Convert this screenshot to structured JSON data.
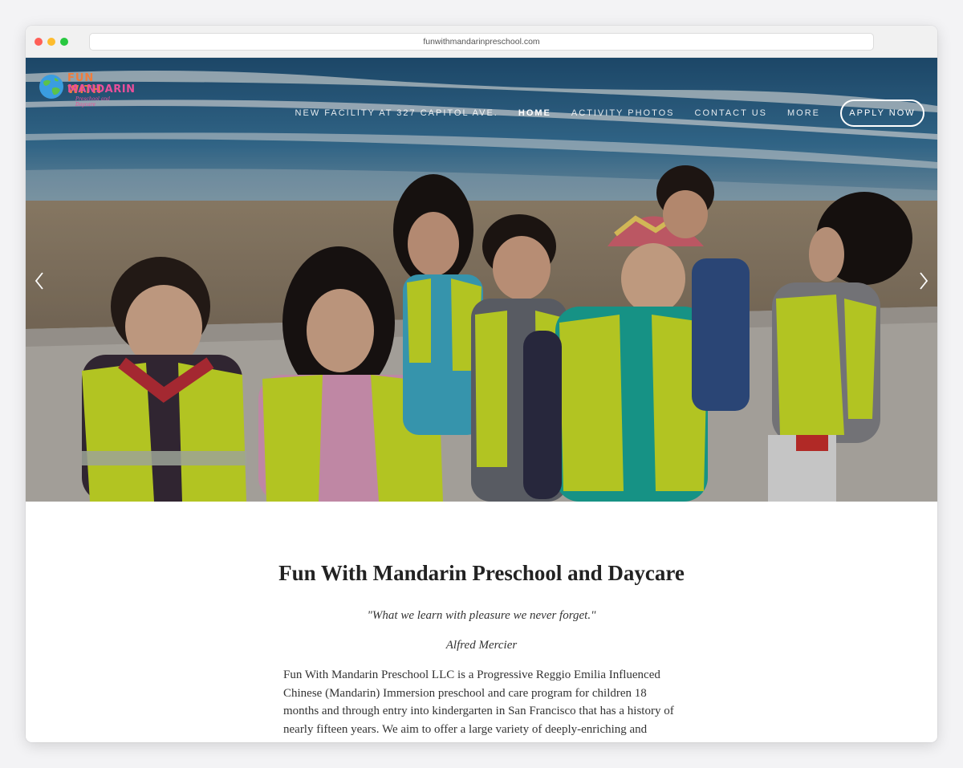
{
  "browser": {
    "url": "funwithmandarinpreschool.com"
  },
  "logo": {
    "line1": "FUN WITH",
    "line2": "MANDARIN",
    "line3": "Preschool and Daycare",
    "icon": "globe-icon"
  },
  "nav": {
    "items": [
      {
        "label": "NEW FACILITY AT 327 CAPITOL AVE."
      },
      {
        "label": "HOME"
      },
      {
        "label": "ACTIVITY PHOTOS"
      },
      {
        "label": "CONTACT US"
      },
      {
        "label": "MORE"
      }
    ],
    "apply_label": "APPLY NOW"
  },
  "hero": {
    "prev_icon": "chevron-left-icon",
    "next_icon": "chevron-right-icon"
  },
  "content": {
    "title": "Fun With Mandarin Preschool and Daycare",
    "quote": "\"What we learn with pleasure we never forget.\"",
    "author": "Alfred Mercier",
    "paragraph": "Fun With Mandarin Preschool LLC is a Progressive Reggio Emilia Influenced Chinese (Mandarin) Immersion preschool and care program for children 18 months and through entry into kindergarten in San Francisco that has a history of nearly fifteen years.  We aim to offer a large variety of deeply-enriching and complete indoor and outdoor experiences"
  },
  "colors": {
    "text": "#333333",
    "title": "#222222",
    "vest": "#d9ef2a",
    "ocean": "#2f6e9a",
    "sand": "#9c8a72"
  }
}
